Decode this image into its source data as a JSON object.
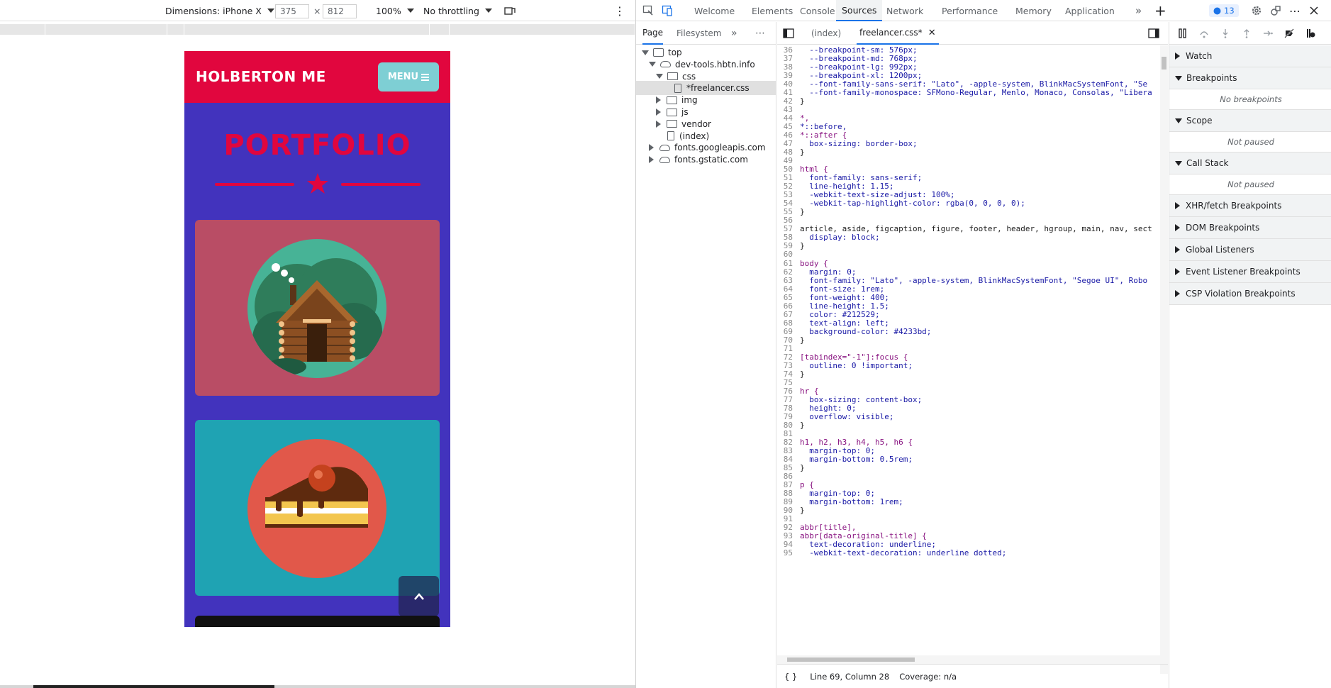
{
  "emulation": {
    "device_label": "Dimensions: iPhone X",
    "width_value": "375",
    "times": "×",
    "height_value": "812",
    "zoom": "100%",
    "throttling": "No throttling",
    "more": "⋮"
  },
  "site": {
    "brand": "HOLBERTON ME",
    "menu_label": "MENU",
    "section_title": "PORTFOLIO",
    "colors": {
      "nav": "#e1063e",
      "body": "#4233bd",
      "menu_btn": "#7ecfd4",
      "card1": "#b94d65",
      "card2": "#1fa3b3"
    }
  },
  "devtools": {
    "tabs": [
      "Welcome",
      "Elements",
      "Console",
      "Sources",
      "Network",
      "Performance",
      "Memory",
      "Application"
    ],
    "active_tab": "Sources",
    "issues_count": "13",
    "navigator": {
      "tabs": [
        "Page",
        "Filesystem"
      ],
      "tree": [
        {
          "label": "top",
          "depth": 0,
          "icon": "frame",
          "open": true
        },
        {
          "label": "dev-tools.hbtn.info",
          "depth": 1,
          "icon": "cloud",
          "open": true
        },
        {
          "label": "css",
          "depth": 2,
          "icon": "folder",
          "open": true
        },
        {
          "label": "*freelancer.css",
          "depth": 3,
          "icon": "file",
          "selected": true
        },
        {
          "label": "img",
          "depth": 2,
          "icon": "folder",
          "open": false
        },
        {
          "label": "js",
          "depth": 2,
          "icon": "folder",
          "open": false
        },
        {
          "label": "vendor",
          "depth": 2,
          "icon": "folder",
          "open": false
        },
        {
          "label": "(index)",
          "depth": 2,
          "icon": "file"
        },
        {
          "label": "fonts.googleapis.com",
          "depth": 1,
          "icon": "cloud",
          "open": false
        },
        {
          "label": "fonts.gstatic.com",
          "depth": 1,
          "icon": "cloud",
          "open": false
        }
      ]
    },
    "editor": {
      "tabs": [
        "(index)",
        "freelancer.css*"
      ],
      "lines": [
        {
          "n": "36",
          "t": "  --breakpoint-sm: 576px;"
        },
        {
          "n": "37",
          "t": "  --breakpoint-md: 768px;"
        },
        {
          "n": "38",
          "t": "  --breakpoint-lg: 992px;"
        },
        {
          "n": "39",
          "t": "  --breakpoint-xl: 1200px;"
        },
        {
          "n": "40",
          "t": "  --font-family-sans-serif: \"Lato\", -apple-system, BlinkMacSystemFont, \"Se"
        },
        {
          "n": "41",
          "t": "  --font-family-monospace: SFMono-Regular, Menlo, Monaco, Consolas, \"Libera"
        },
        {
          "n": "42",
          "t": "}"
        },
        {
          "n": "43",
          "t": ""
        },
        {
          "n": "44",
          "t": "*,"
        },
        {
          "n": "45",
          "t": "*::before,"
        },
        {
          "n": "46",
          "t": "*::after {"
        },
        {
          "n": "47",
          "t": "  box-sizing: border-box;"
        },
        {
          "n": "48",
          "t": "}"
        },
        {
          "n": "49",
          "t": ""
        },
        {
          "n": "50",
          "t": "html {"
        },
        {
          "n": "51",
          "t": "  font-family: sans-serif;"
        },
        {
          "n": "52",
          "t": "  line-height: 1.15;"
        },
        {
          "n": "53",
          "t": "  -webkit-text-size-adjust: 100%;"
        },
        {
          "n": "54",
          "t": "  -webkit-tap-highlight-color: rgba(0, 0, 0, 0);"
        },
        {
          "n": "55",
          "t": "}"
        },
        {
          "n": "56",
          "t": ""
        },
        {
          "n": "57",
          "t": "article, aside, figcaption, figure, footer, header, hgroup, main, nav, sect"
        },
        {
          "n": "58",
          "t": "  display: block;"
        },
        {
          "n": "59",
          "t": "}"
        },
        {
          "n": "60",
          "t": ""
        },
        {
          "n": "61",
          "t": "body {"
        },
        {
          "n": "62",
          "t": "  margin: 0;"
        },
        {
          "n": "63",
          "t": "  font-family: \"Lato\", -apple-system, BlinkMacSystemFont, \"Segoe UI\", Robo"
        },
        {
          "n": "64",
          "t": "  font-size: 1rem;"
        },
        {
          "n": "65",
          "t": "  font-weight: 400;"
        },
        {
          "n": "66",
          "t": "  line-height: 1.5;"
        },
        {
          "n": "67",
          "t": "  color: #212529;"
        },
        {
          "n": "68",
          "t": "  text-align: left;"
        },
        {
          "n": "69",
          "t": "  background-color: #4233bd;"
        },
        {
          "n": "70",
          "t": "}"
        },
        {
          "n": "71",
          "t": ""
        },
        {
          "n": "72",
          "t": "[tabindex=\"-1\"]:focus {"
        },
        {
          "n": "73",
          "t": "  outline: 0 !important;"
        },
        {
          "n": "74",
          "t": "}"
        },
        {
          "n": "75",
          "t": ""
        },
        {
          "n": "76",
          "t": "hr {"
        },
        {
          "n": "77",
          "t": "  box-sizing: content-box;"
        },
        {
          "n": "78",
          "t": "  height: 0;"
        },
        {
          "n": "79",
          "t": "  overflow: visible;"
        },
        {
          "n": "80",
          "t": "}"
        },
        {
          "n": "81",
          "t": ""
        },
        {
          "n": "82",
          "t": "h1, h2, h3, h4, h5, h6 {"
        },
        {
          "n": "83",
          "t": "  margin-top: 0;"
        },
        {
          "n": "84",
          "t": "  margin-bottom: 0.5rem;"
        },
        {
          "n": "85",
          "t": "}"
        },
        {
          "n": "86",
          "t": ""
        },
        {
          "n": "87",
          "t": "p {"
        },
        {
          "n": "88",
          "t": "  margin-top: 0;"
        },
        {
          "n": "89",
          "t": "  margin-bottom: 1rem;"
        },
        {
          "n": "90",
          "t": "}"
        },
        {
          "n": "91",
          "t": ""
        },
        {
          "n": "92",
          "t": "abbr[title],"
        },
        {
          "n": "93",
          "t": "abbr[data-original-title] {"
        },
        {
          "n": "94",
          "t": "  text-decoration: underline;"
        },
        {
          "n": "95",
          "t": "  -webkit-text-decoration: underline dotted;"
        }
      ],
      "status": "Line 69, Column 28",
      "coverage": "Coverage: n/a",
      "braces": "{ }"
    },
    "debugger": {
      "sections": [
        {
          "label": "Watch",
          "open": false
        },
        {
          "label": "Breakpoints",
          "open": true,
          "empty": "No breakpoints"
        },
        {
          "label": "Scope",
          "open": true,
          "empty": "Not paused"
        },
        {
          "label": "Call Stack",
          "open": true,
          "empty": "Not paused"
        },
        {
          "label": "XHR/fetch Breakpoints",
          "open": false
        },
        {
          "label": "DOM Breakpoints",
          "open": false
        },
        {
          "label": "Global Listeners",
          "open": false
        },
        {
          "label": "Event Listener Breakpoints",
          "open": false
        },
        {
          "label": "CSP Violation Breakpoints",
          "open": false
        }
      ]
    }
  }
}
